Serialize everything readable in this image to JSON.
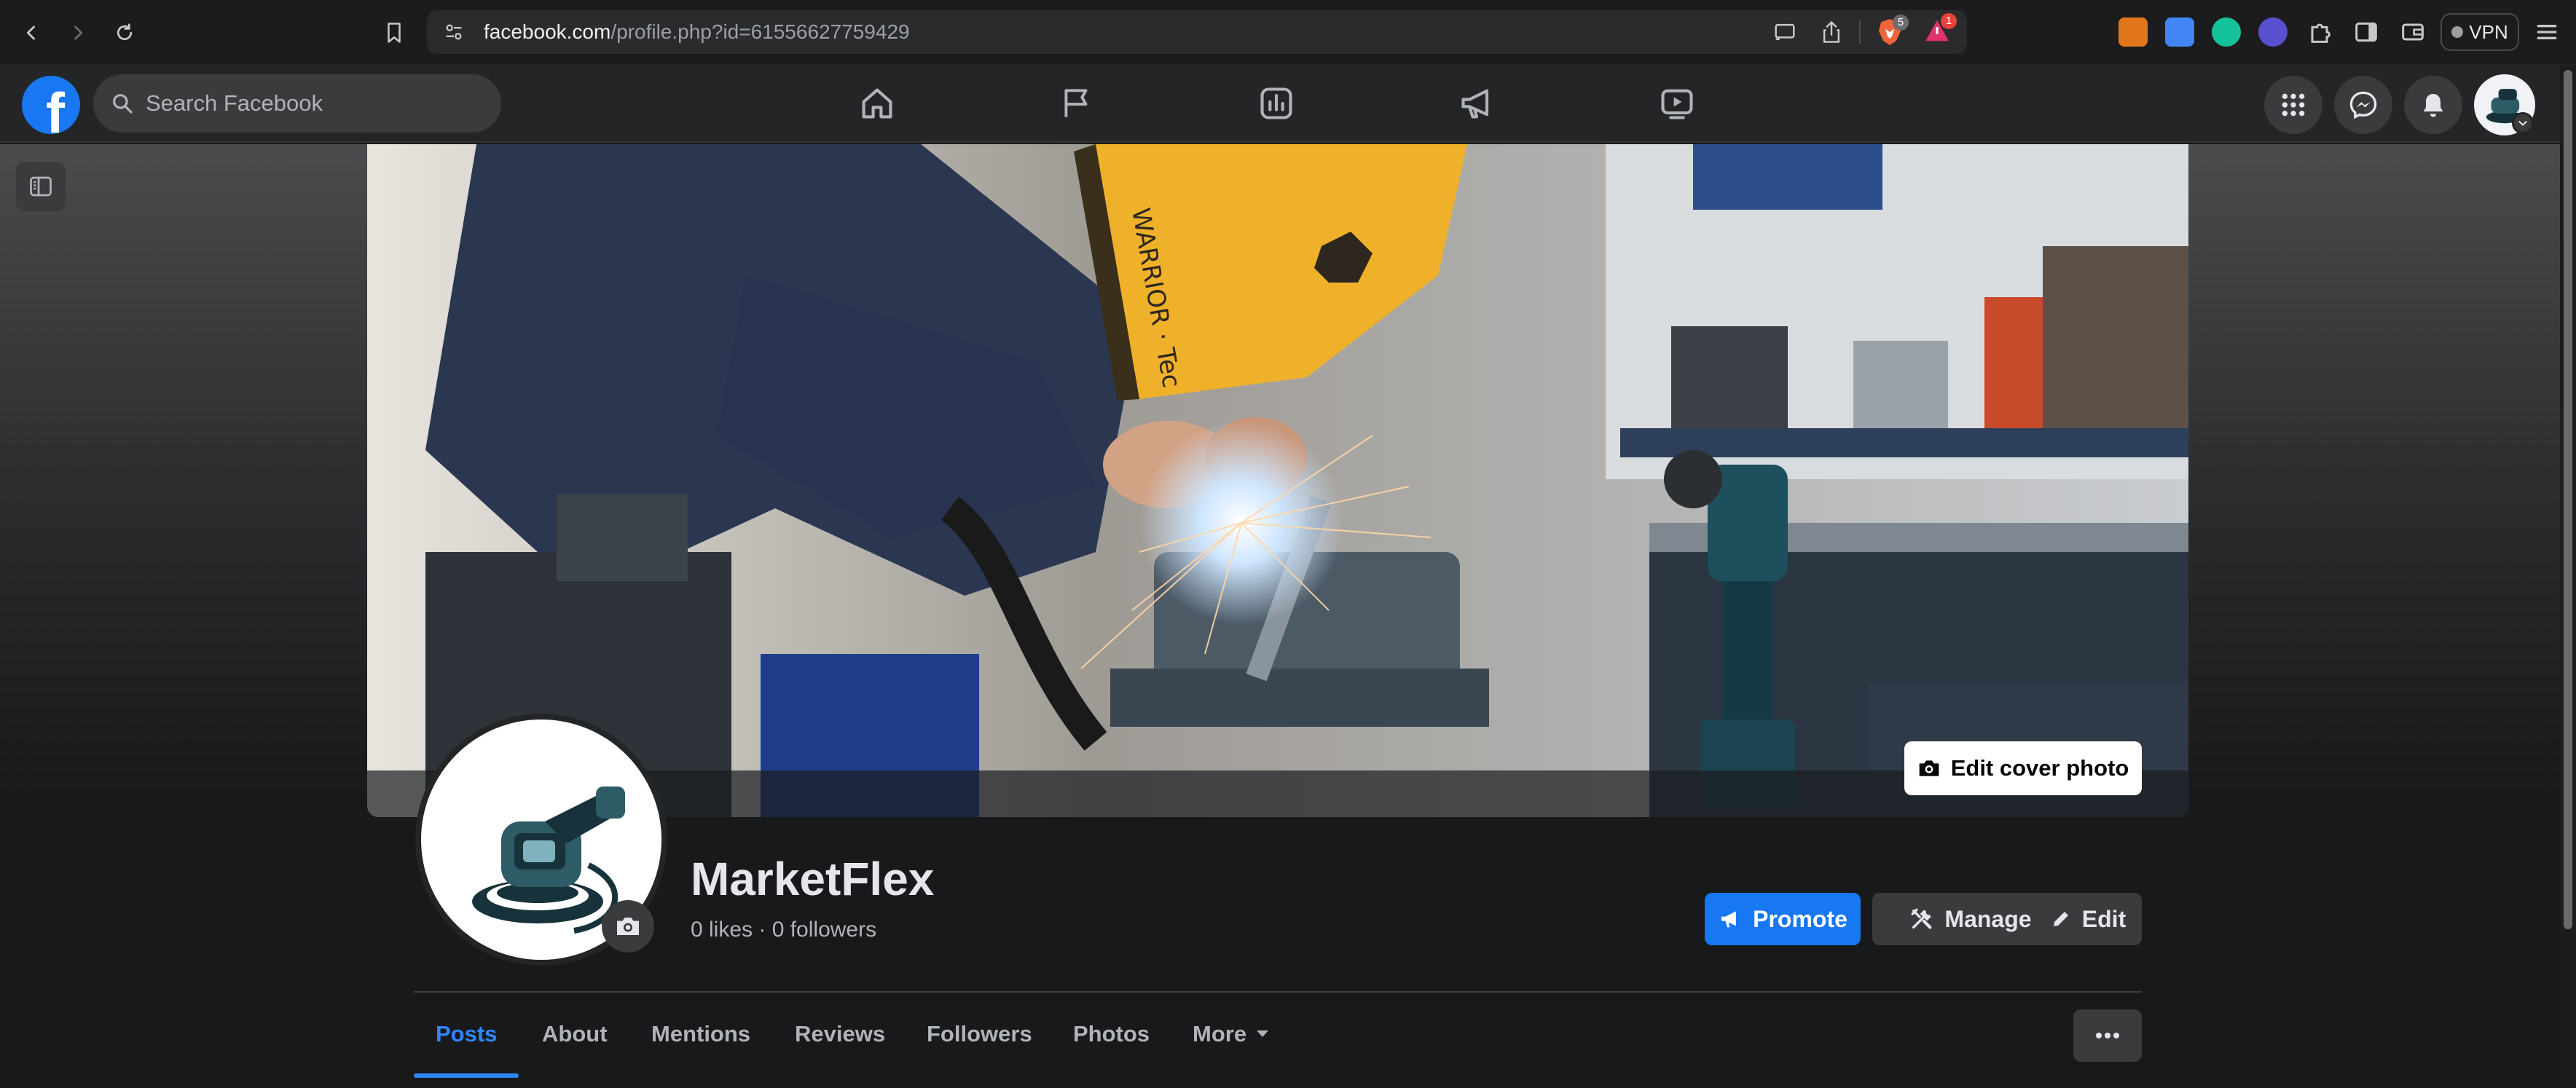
{
  "browser": {
    "url_host": "facebook.com",
    "url_path": "/profile.php?id=61556627759429",
    "brave_badge": "5",
    "alert_badge": "1",
    "vpn_label": "VPN"
  },
  "header": {
    "search_placeholder": "Search Facebook",
    "nav": [
      "home-icon",
      "flag-icon",
      "insights-icon",
      "megaphone-icon",
      "video-icon"
    ],
    "right": [
      "apps-grid-icon",
      "messenger-icon",
      "bell-icon"
    ]
  },
  "cover": {
    "edit_label": "Edit cover photo",
    "helmet_text": "WARRIOR · Tec"
  },
  "profile": {
    "name": "MarketFlex",
    "stats": "0 likes · 0 followers"
  },
  "actions": {
    "promote": "Promote",
    "manage": "Manage",
    "edit": "Edit"
  },
  "tabs": [
    "Posts",
    "About",
    "Mentions",
    "Reviews",
    "Followers",
    "Photos",
    "More"
  ],
  "colors": {
    "fb_blue": "#1877f2",
    "active_tab": "#2d88ff",
    "surface": "#242526",
    "button_gray": "#3a3b3c"
  }
}
